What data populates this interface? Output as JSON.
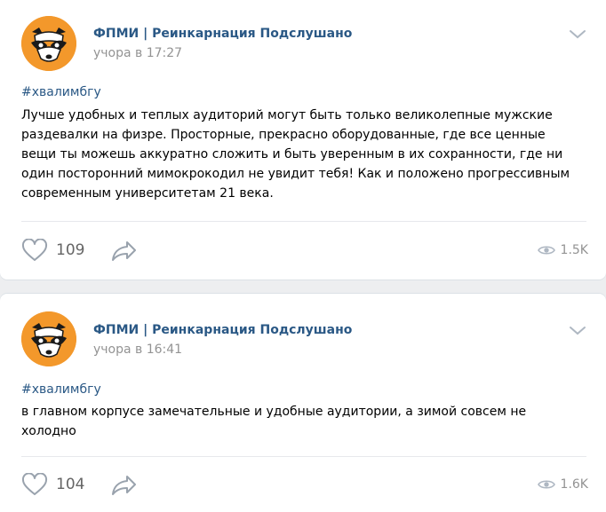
{
  "posts": [
    {
      "author": "ФПМИ | Реинкарнация Подслушано",
      "time": "учора в 17:27",
      "hashtag": "#хвалимбгу",
      "text_lines": [
        "Лучше удобных и теплых аудиторий могут быть только великолепные мужские",
        "раздевалки на физре. Просторные, прекрасно оборудованные, где все ценные",
        "вещи ты можешь аккуратно сложить и быть уверенным в их сохранности, где ни",
        "один посторонний мимокрокодил не увидит тебя! Как и положено прогрессивным",
        "современным университетам 21 века."
      ],
      "likes": "109",
      "views": "1.5K"
    },
    {
      "author": "ФПМИ | Реинкарнация Подслушано",
      "time": "учора в 16:41",
      "hashtag": "#хвалимбгу",
      "text_lines": [
        "в главном корпусе замечательные и удобные аудитории, а зимой совсем не",
        "холодно"
      ],
      "likes": "104",
      "views": "1.6K"
    }
  ],
  "icons": {
    "avatar": "raccoon-avatar",
    "menu": "chevron-down-icon",
    "like": "heart-icon",
    "share": "share-arrow-icon",
    "views": "eye-icon"
  },
  "colors": {
    "page_bg": "#edeef0",
    "card_bg": "#ffffff",
    "link": "#2a5885",
    "muted": "#939393",
    "avatar_bg": "#f3982b"
  }
}
